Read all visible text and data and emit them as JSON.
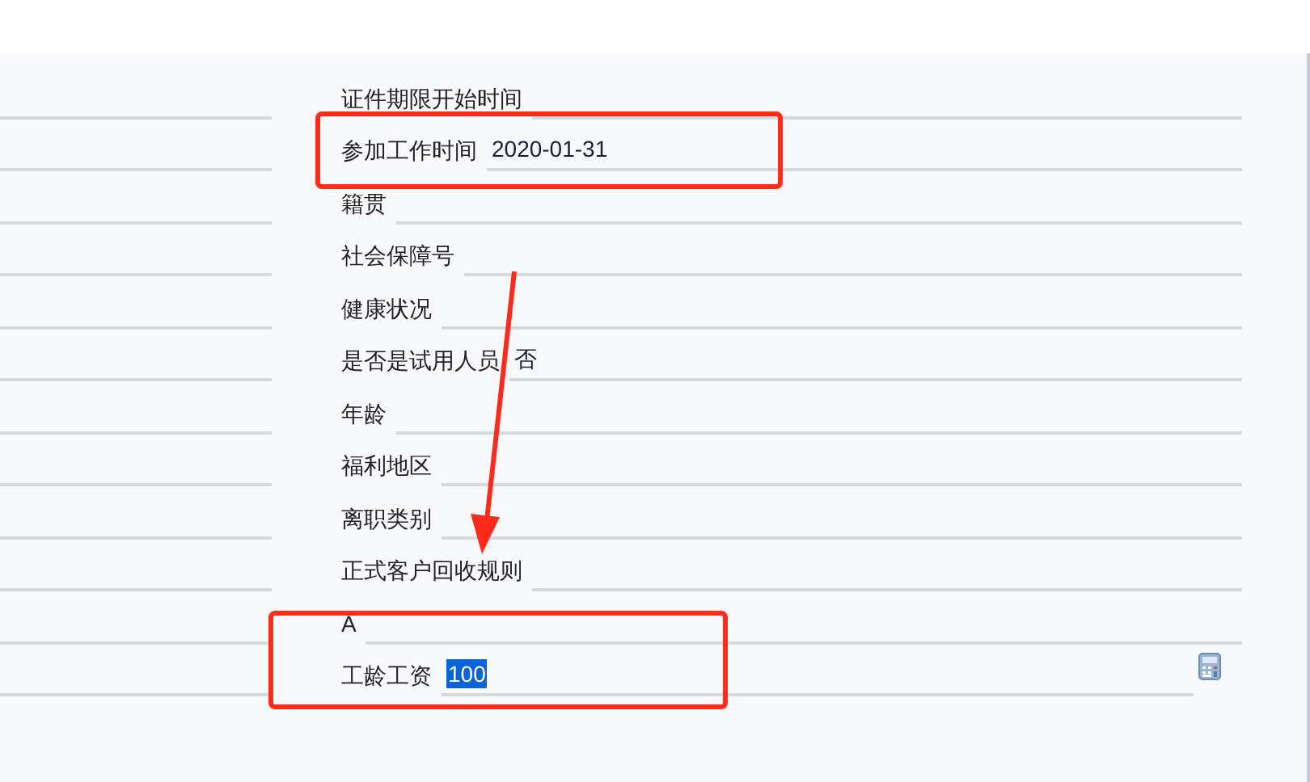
{
  "fields": [
    {
      "label": "证件期限开始时间",
      "kind": "text"
    },
    {
      "label": "参加工作时间",
      "value": "2020-01-31",
      "kind": "text"
    },
    {
      "label": "籍贯",
      "kind": "text"
    },
    {
      "label": "社会保障号",
      "kind": "text"
    },
    {
      "label": "健康状况",
      "kind": "text"
    },
    {
      "label": "是否是试用人员",
      "value": "否",
      "kind": "text"
    },
    {
      "label": "年龄",
      "kind": "text"
    },
    {
      "label": "福利地区",
      "kind": "text"
    },
    {
      "label": "离职类别",
      "kind": "text"
    },
    {
      "label": "正式客户回收规则",
      "kind": "text"
    },
    {
      "label": "A",
      "kind": "text"
    },
    {
      "label": "工龄工资",
      "value": "100",
      "value_selected": true,
      "kind": "number"
    }
  ]
}
